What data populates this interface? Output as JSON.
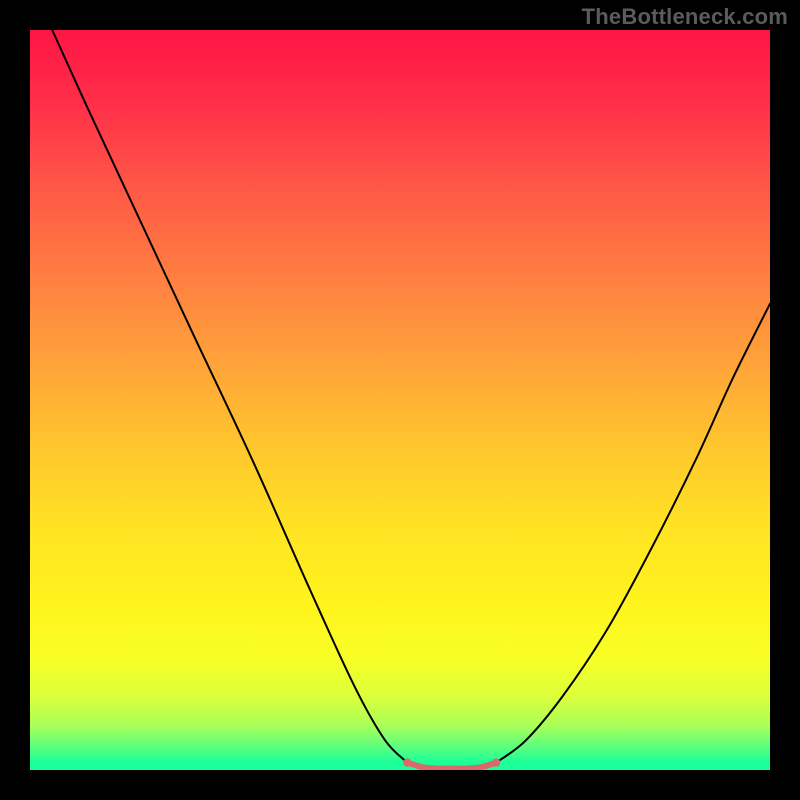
{
  "watermark": "TheBottleneck.com",
  "chart_data": {
    "type": "line",
    "title": "",
    "xlabel": "",
    "ylabel": "",
    "xlim": [
      0,
      100
    ],
    "ylim": [
      0,
      100
    ],
    "grid": false,
    "legend": false,
    "gradient_stops": [
      {
        "pos": 0,
        "color": "#ff1544"
      },
      {
        "pos": 10,
        "color": "#ff2f49"
      },
      {
        "pos": 22,
        "color": "#ff5a46"
      },
      {
        "pos": 35,
        "color": "#ff8440"
      },
      {
        "pos": 47,
        "color": "#ffa937"
      },
      {
        "pos": 58,
        "color": "#ffcb2c"
      },
      {
        "pos": 68,
        "color": "#ffe423"
      },
      {
        "pos": 78,
        "color": "#fff41c"
      },
      {
        "pos": 85,
        "color": "#f7ff26"
      },
      {
        "pos": 90,
        "color": "#dcff3a"
      },
      {
        "pos": 94,
        "color": "#a9ff58"
      },
      {
        "pos": 97,
        "color": "#58ff80"
      },
      {
        "pos": 99,
        "color": "#1aff99"
      },
      {
        "pos": 100,
        "color": "#19ff99"
      }
    ],
    "series": [
      {
        "name": "left-descent",
        "color": "#000000",
        "width": 2,
        "x": [
          3,
          8,
          15,
          22,
          30,
          38,
          44,
          48,
          51
        ],
        "y": [
          100,
          89,
          74,
          59,
          42,
          24,
          11,
          4,
          1
        ]
      },
      {
        "name": "right-ascent",
        "color": "#000000",
        "width": 2,
        "x": [
          63,
          67,
          72,
          78,
          84,
          90,
          95,
          100
        ],
        "y": [
          1,
          4,
          10,
          19,
          30,
          42,
          53,
          63
        ]
      },
      {
        "name": "valley-highlight",
        "color": "#d96a6a",
        "width": 6,
        "x": [
          51,
          53,
          55,
          57,
          59,
          61,
          63
        ],
        "y": [
          1.0,
          0.4,
          0.2,
          0.2,
          0.2,
          0.4,
          1.0
        ]
      }
    ],
    "highlight_endpoints": {
      "color": "#d96a6a",
      "radius": 4.2,
      "points": [
        {
          "x": 51,
          "y": 1.0
        },
        {
          "x": 63,
          "y": 1.0
        }
      ]
    }
  }
}
